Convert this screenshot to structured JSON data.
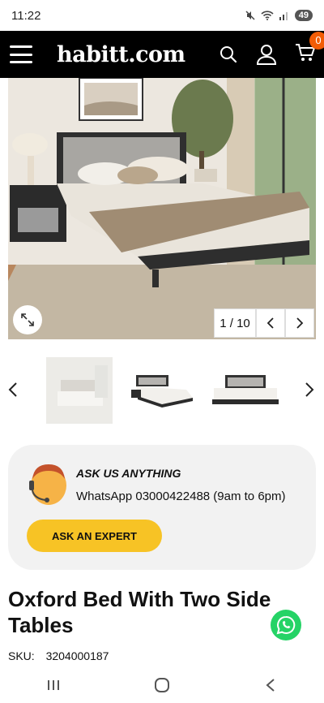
{
  "status_bar": {
    "time": "11:22",
    "battery": "49"
  },
  "header": {
    "logo": "habitt.com",
    "cart_count": "0"
  },
  "gallery": {
    "counter": "1 / 10"
  },
  "ask": {
    "title": "ASK US ANYTHING",
    "whatsapp": "WhatsApp 03000422488 (9am to 6pm)",
    "button": "ASK AN EXPERT"
  },
  "product": {
    "title": "Oxford Bed With Two Side Tables",
    "sku_label": "SKU:",
    "sku_value": "3204000187"
  },
  "colors": {
    "accent": "#f7c325",
    "cart_badge": "#f25c05",
    "whatsapp": "#25d366"
  },
  "icons": [
    "menu-icon",
    "search-icon",
    "user-icon",
    "cart-icon",
    "expand-icon",
    "chevron-left-icon",
    "chevron-right-icon",
    "whatsapp-icon"
  ]
}
